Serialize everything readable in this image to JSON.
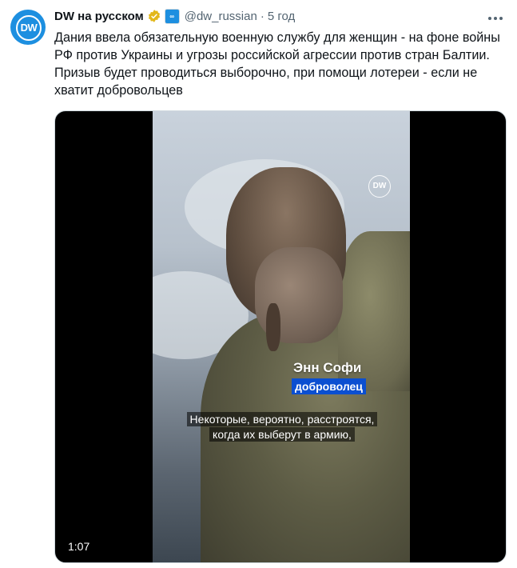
{
  "tweet": {
    "name": "DW на русском",
    "handle": "@dw_russian",
    "time": "5 год",
    "text": "Дания ввела обязательную военную службу для женщин - на фоне войны РФ против Украины и угрозы российской агрессии против стран Балтии. Призыв будет проводиться выборочно, при помощи лотереи - если не хватит добровольцев"
  },
  "avatar": {
    "logo_text": "DW"
  },
  "icons": {
    "verified": "verified-badge-icon",
    "affiliate": "affiliate-badge-icon",
    "more": "more-options-icon"
  },
  "video": {
    "watermark": "DW",
    "person_name": "Энн Софи",
    "person_role": "доброволец",
    "subtitle_line1": "Некоторые, вероятно, расстроятся,",
    "subtitle_line2": "когда их выберут в армию,",
    "duration": "1:07"
  },
  "colors": {
    "accent": "#1d8fe0",
    "text": "#0f1419",
    "secondary": "#536471",
    "role_bg": "#0b4fd1",
    "verified_gold": "#e2b719"
  }
}
